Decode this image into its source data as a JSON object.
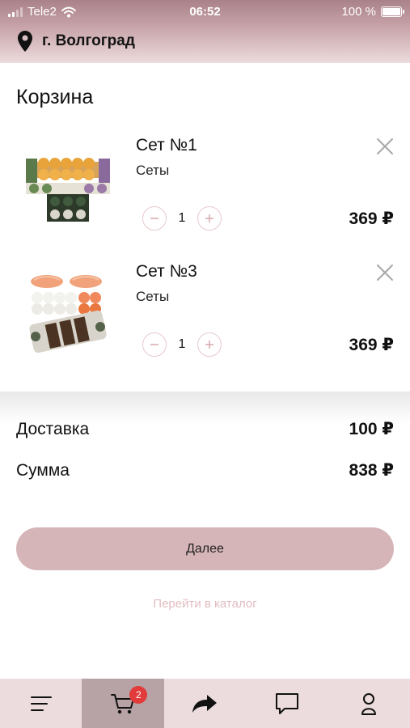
{
  "status_bar": {
    "carrier": "Tele2",
    "time": "06:52",
    "battery": "100 %"
  },
  "header": {
    "city": "г. Волгоград"
  },
  "page_title": "Корзина",
  "cart_items": [
    {
      "name": "Сет №1",
      "category": "Сеты",
      "quantity": "1",
      "price": "369 ₽"
    },
    {
      "name": "Сет №3",
      "category": "Сеты",
      "quantity": "1",
      "price": "369 ₽"
    }
  ],
  "summary": {
    "delivery_label": "Доставка",
    "delivery_value": "100 ₽",
    "total_label": "Сумма",
    "total_value": "838 ₽"
  },
  "actions": {
    "next_label": "Далее",
    "catalog_link": "Перейти в каталог"
  },
  "bottom_nav": {
    "items": [
      {
        "icon": "menu-icon"
      },
      {
        "icon": "cart-icon",
        "badge": "2",
        "active": true
      },
      {
        "icon": "share-icon"
      },
      {
        "icon": "chat-icon"
      },
      {
        "icon": "profile-icon"
      }
    ]
  },
  "colors": {
    "accent": "#d6b5b8",
    "header_dark": "#a98289",
    "nav_bg": "#ecdcdd",
    "nav_active": "#b7a3a6",
    "badge": "#e23b3b",
    "link": "#e2bcc0"
  }
}
